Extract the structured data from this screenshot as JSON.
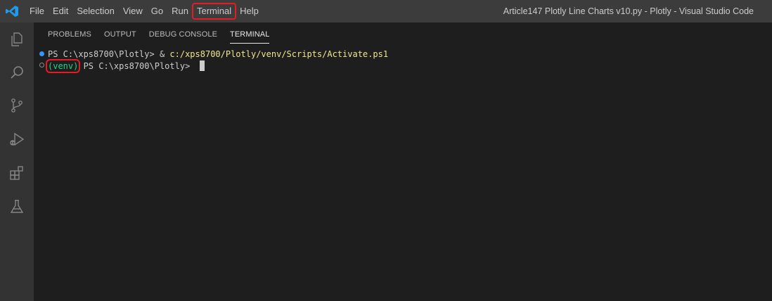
{
  "menu": {
    "items": [
      "File",
      "Edit",
      "Selection",
      "View",
      "Go",
      "Run",
      "Terminal",
      "Help"
    ],
    "highlighted": "Terminal"
  },
  "window": {
    "title": "Article147 Plotly Line Charts v10.py - Plotly - Visual Studio Code"
  },
  "activity_bar": {
    "icons": [
      "explorer-icon",
      "search-icon",
      "source-control-icon",
      "run-debug-icon",
      "extensions-icon",
      "testing-icon"
    ]
  },
  "panel": {
    "tabs": [
      {
        "label": "PROBLEMS",
        "active": false
      },
      {
        "label": "OUTPUT",
        "active": false
      },
      {
        "label": "DEBUG CONSOLE",
        "active": false
      },
      {
        "label": "TERMINAL",
        "active": true
      }
    ]
  },
  "terminal": {
    "line1": {
      "prompt": "PS C:\\xps8700\\Plotly> & ",
      "command": "c:/xps8700/Plotly/venv/Scripts/Activate.ps1"
    },
    "line2": {
      "venv": "(venv)",
      "prompt": " PS C:\\xps8700\\Plotly> "
    }
  },
  "colors": {
    "highlight_box": "#e51c23",
    "venv_text": "#23d18b",
    "command_text": "#f0e68c",
    "accent": "#3794ff"
  }
}
